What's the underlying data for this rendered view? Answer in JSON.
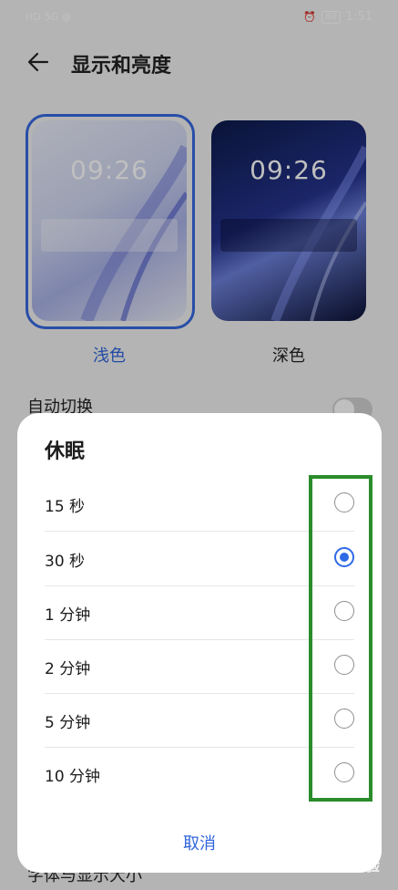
{
  "status": {
    "time": "1:51",
    "battery": "80",
    "network": "HD",
    "signal": "5G"
  },
  "header": {
    "title": "显示和亮度"
  },
  "themes": [
    {
      "label": "浅色",
      "time": "09:26",
      "selected": true
    },
    {
      "label": "深色",
      "time": "09:26",
      "selected": false
    }
  ],
  "settings": {
    "auto_switch_label": "自动切换",
    "bottom_label": "字体与显示大小"
  },
  "dialog": {
    "title": "休眠",
    "options": [
      {
        "label": "15 秒",
        "selected": false
      },
      {
        "label": "30 秒",
        "selected": true
      },
      {
        "label": "1 分钟",
        "selected": false
      },
      {
        "label": "2 分钟",
        "selected": false
      },
      {
        "label": "5 分钟",
        "selected": false
      },
      {
        "label": "10 分钟",
        "selected": false
      }
    ],
    "cancel": "取消"
  },
  "colors": {
    "accent": "#2f64db",
    "highlight": "#2a8c2a"
  },
  "watermark": "Baidu 经验"
}
